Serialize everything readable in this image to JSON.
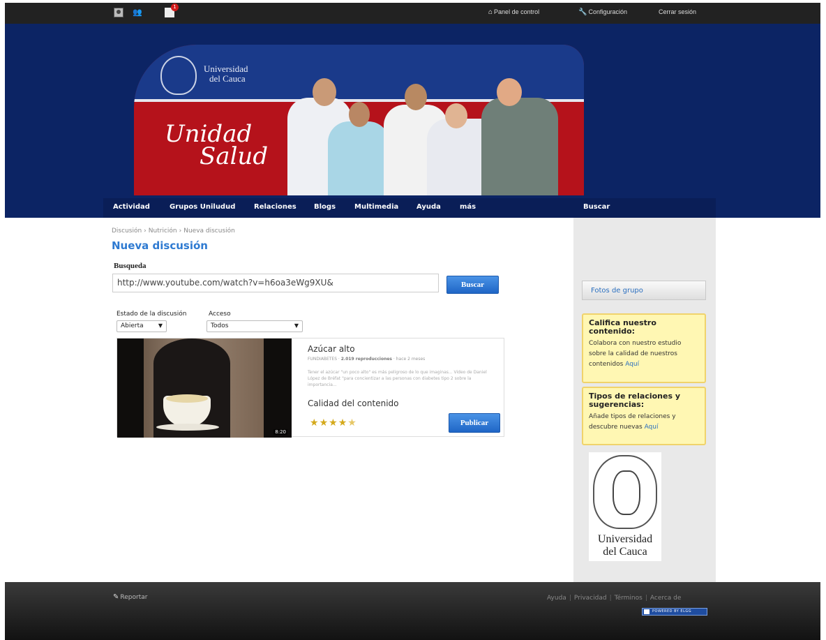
{
  "topbar": {
    "mail_badge": "1",
    "panel_label": "Panel de control",
    "config_label": "Configuración",
    "logout_label": "Cerrar sesión"
  },
  "header": {
    "university_line1": "Universidad",
    "university_line2": "del Cauca",
    "title_line1": "Unidad",
    "title_line2": "Salud"
  },
  "nav": {
    "items": [
      "Actividad",
      "Grupos Uniludud",
      "Relaciones",
      "Blogs",
      "Multimedia",
      "Ayuda",
      "más"
    ],
    "search_tab": "Buscar"
  },
  "breadcrumb": {
    "items": [
      "Discusión",
      "Nutrición",
      "Nueva discusión"
    ]
  },
  "page_title": "Nueva discusión",
  "search": {
    "label": "Busqueda",
    "value": "http://www.youtube.com/watch?v=h6oa3eWg9XU&",
    "button": "Buscar"
  },
  "filters": {
    "estado_label": "Estado de la discusión",
    "estado_value": "Abierta",
    "acceso_label": "Acceso",
    "acceso_value": "Todos"
  },
  "video": {
    "title": "Azúcar alto",
    "channel": "FUNDIABETES",
    "views": "2.019 reproducciones",
    "age": "hace 2 meses",
    "description": "Tener el azúcar \"un poco alto\" es más peligroso de lo que imaginas... Video de Daniel López de Bréfat \"para concientizar a las personas con diabetes tipo 2 sobre la importancia...",
    "duration": "8:20",
    "quality_label": "Calidad del contenido",
    "rating": 4.5,
    "publish_button": "Publicar"
  },
  "sidebar": {
    "fotos_button": "Fotos de grupo",
    "box1": {
      "title": "Califica nuestro contenido:",
      "text": "Colabora con nuestro estudio sobre la calidad de nuestros contenidos",
      "link": "Aquí"
    },
    "box2": {
      "title": "Tipos de relaciones y sugerencias:",
      "text": "Añade tipos de relaciones y descubre nuevas",
      "link": "Aquí"
    },
    "logo_line1": "Universidad",
    "logo_line2": "del Cauca"
  },
  "footer": {
    "report": "Reportar",
    "links": [
      "Ayuda",
      "Privacidad",
      "Términos",
      "Acerca de"
    ],
    "powered": "POWERED BY ELGG"
  },
  "colors": {
    "header_bg": "#0c2464",
    "banner_red": "#b5121b",
    "link_blue": "#2e7ad1",
    "button_blue": "#1f66c6",
    "note_yellow": "#fff7b3"
  }
}
